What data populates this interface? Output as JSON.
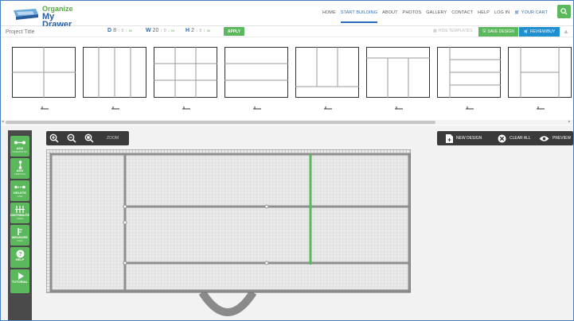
{
  "brand": {
    "line1": "Organize",
    "line2": "My Drawer"
  },
  "nav": {
    "items": [
      "HOME",
      "START BUILDING",
      "ABOUT",
      "PHOTOS",
      "GALLERY",
      "CONTACT",
      "HELP",
      "LOG IN"
    ],
    "cart": "YOUR CART"
  },
  "toolbar": {
    "title_placeholder": "Project Title",
    "dims": [
      {
        "key": "D",
        "value": "8",
        "frac": "0",
        "unit": "IN"
      },
      {
        "key": "W",
        "value": "20",
        "frac": "0",
        "unit": "IN"
      },
      {
        "key": "H",
        "value": "2",
        "frac": "0",
        "unit": "IN"
      }
    ],
    "apply": "APPLY",
    "hide_templates": "HIDE TEMPLATES",
    "save": "SAVE DESIGN",
    "review": "REVIEW/BUY"
  },
  "tools": [
    {
      "label": "ADD",
      "sub": "HORIZONTAL",
      "icon": "add-horizontal-icon"
    },
    {
      "label": "ADD",
      "sub": "VERTICAL",
      "icon": "add-vertical-icon"
    },
    {
      "label": "DELETE",
      "sub": "LINE",
      "icon": "delete-line-icon"
    },
    {
      "label": "DISTRIBUTE",
      "sub": "LINES",
      "icon": "distribute-icon"
    },
    {
      "label": "MEASURE",
      "sub": "TOOL",
      "icon": "measure-icon"
    },
    {
      "label": "HELP",
      "sub": "",
      "icon": "help-icon"
    },
    {
      "label": "TUTORIAL",
      "sub": "",
      "icon": "play-icon"
    }
  ],
  "zoom": {
    "label": "ZOOM"
  },
  "actions": {
    "new_design": "NEW DESIGN",
    "clear_all": "CLEAR ALL",
    "preview": "PREVIEW"
  },
  "colors": {
    "green": "#5cb85c",
    "blue": "#1f8fd0",
    "dark": "#3a3a3a",
    "active_line": "#5cb85c"
  }
}
